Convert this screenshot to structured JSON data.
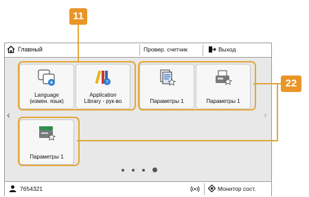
{
  "topbar": {
    "home_label": "Главный",
    "counter_label": "Провер. счетчик",
    "logout_label": "Выход"
  },
  "tiles": [
    {
      "label_line1": "Language",
      "label_line2": "(измен. язык)",
      "icon": "language-icon"
    },
    {
      "label_line1": "Application",
      "label_line2": "Library - рук-во",
      "icon": "library-help-icon"
    },
    {
      "label_line1": "Параметры 1",
      "label_line2": "",
      "icon": "document-star-icon"
    },
    {
      "label_line1": "Параметры 1",
      "label_line2": "",
      "icon": "fax-star-icon"
    },
    {
      "label_line1": "Параметры 1",
      "label_line2": "",
      "icon": "scanner-star-icon"
    }
  ],
  "callouts": {
    "group_a": "11",
    "group_b": "22"
  },
  "bottombar": {
    "user_id": "7654321",
    "status_monitor_label": "Монитор сост."
  },
  "pager": {
    "count": 4,
    "active_index": 3
  },
  "colors": {
    "callout": "#e99527",
    "group_border": "#e3a63a"
  }
}
